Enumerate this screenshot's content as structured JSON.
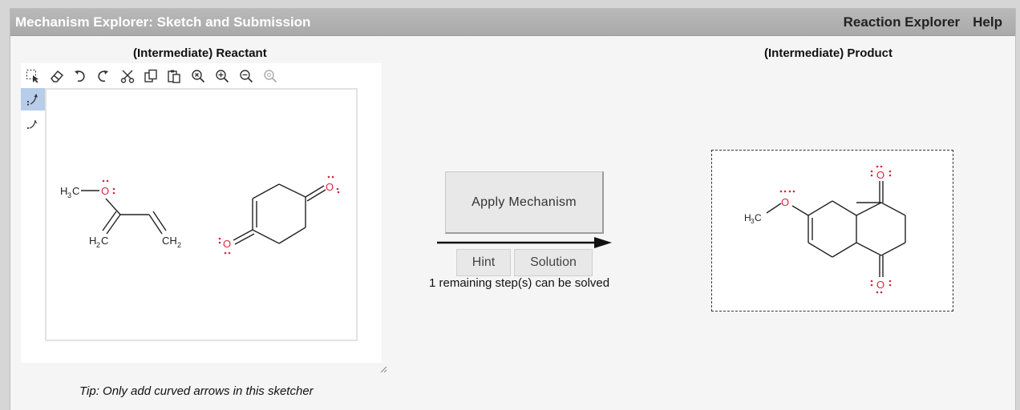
{
  "app": {
    "title": "Mechanism Explorer: Sketch and Submission",
    "nav": [
      "Reaction Explorer",
      "Help"
    ]
  },
  "reactant": {
    "label": "(Intermediate) Reactant",
    "tip": "Tip: Only add curved arrows in this sketcher"
  },
  "product": {
    "label": "(Intermediate) Product"
  },
  "controls": {
    "apply_label": "Apply Mechanism",
    "hint_label": "Hint",
    "solution_label": "Solution",
    "remaining_text": "1 remaining step(s) can be solved"
  },
  "toolbar": [
    "select-icon",
    "eraser-icon",
    "undo-icon",
    "redo-icon",
    "cut-icon",
    "copy-icon",
    "paste-icon",
    "zoom-reset-icon",
    "zoom-in-icon",
    "zoom-out-icon",
    "zoom-fit-icon"
  ],
  "colors": {
    "oxygen": "#d9263c",
    "bond": "#222222",
    "active_tool": "#b7cdea"
  }
}
